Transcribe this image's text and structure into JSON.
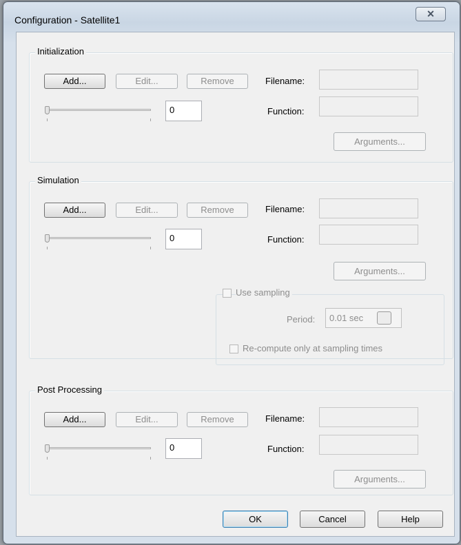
{
  "window": {
    "title": "Configuration - Satellite1",
    "close_glyph": "✕"
  },
  "sections": [
    {
      "title": "Initialization",
      "add": "Add...",
      "edit": "Edit...",
      "remove": "Remove",
      "filename_label": "Filename:",
      "function_label": "Function:",
      "arguments": "Arguments...",
      "slider_value": 0,
      "number_value": "0"
    },
    {
      "title": "Simulation",
      "add": "Add...",
      "edit": "Edit...",
      "remove": "Remove",
      "filename_label": "Filename:",
      "function_label": "Function:",
      "arguments": "Arguments...",
      "slider_value": 0,
      "number_value": "0"
    },
    {
      "title": "Post Processing",
      "add": "Add...",
      "edit": "Edit...",
      "remove": "Remove",
      "filename_label": "Filename:",
      "function_label": "Function:",
      "arguments": "Arguments...",
      "slider_value": 0,
      "number_value": "0"
    }
  ],
  "sampling": {
    "use_sampling_label": "Use sampling",
    "use_sampling_checked": false,
    "period_label": "Period:",
    "period_value": "0.01 sec",
    "recompute_label": "Re-compute only at sampling times",
    "recompute_checked": false
  },
  "footer": {
    "ok": "OK",
    "cancel": "Cancel",
    "help": "Help"
  },
  "colors": {
    "disabled_text": "#8d8d8d",
    "default_button_border": "#3c7fb1"
  }
}
